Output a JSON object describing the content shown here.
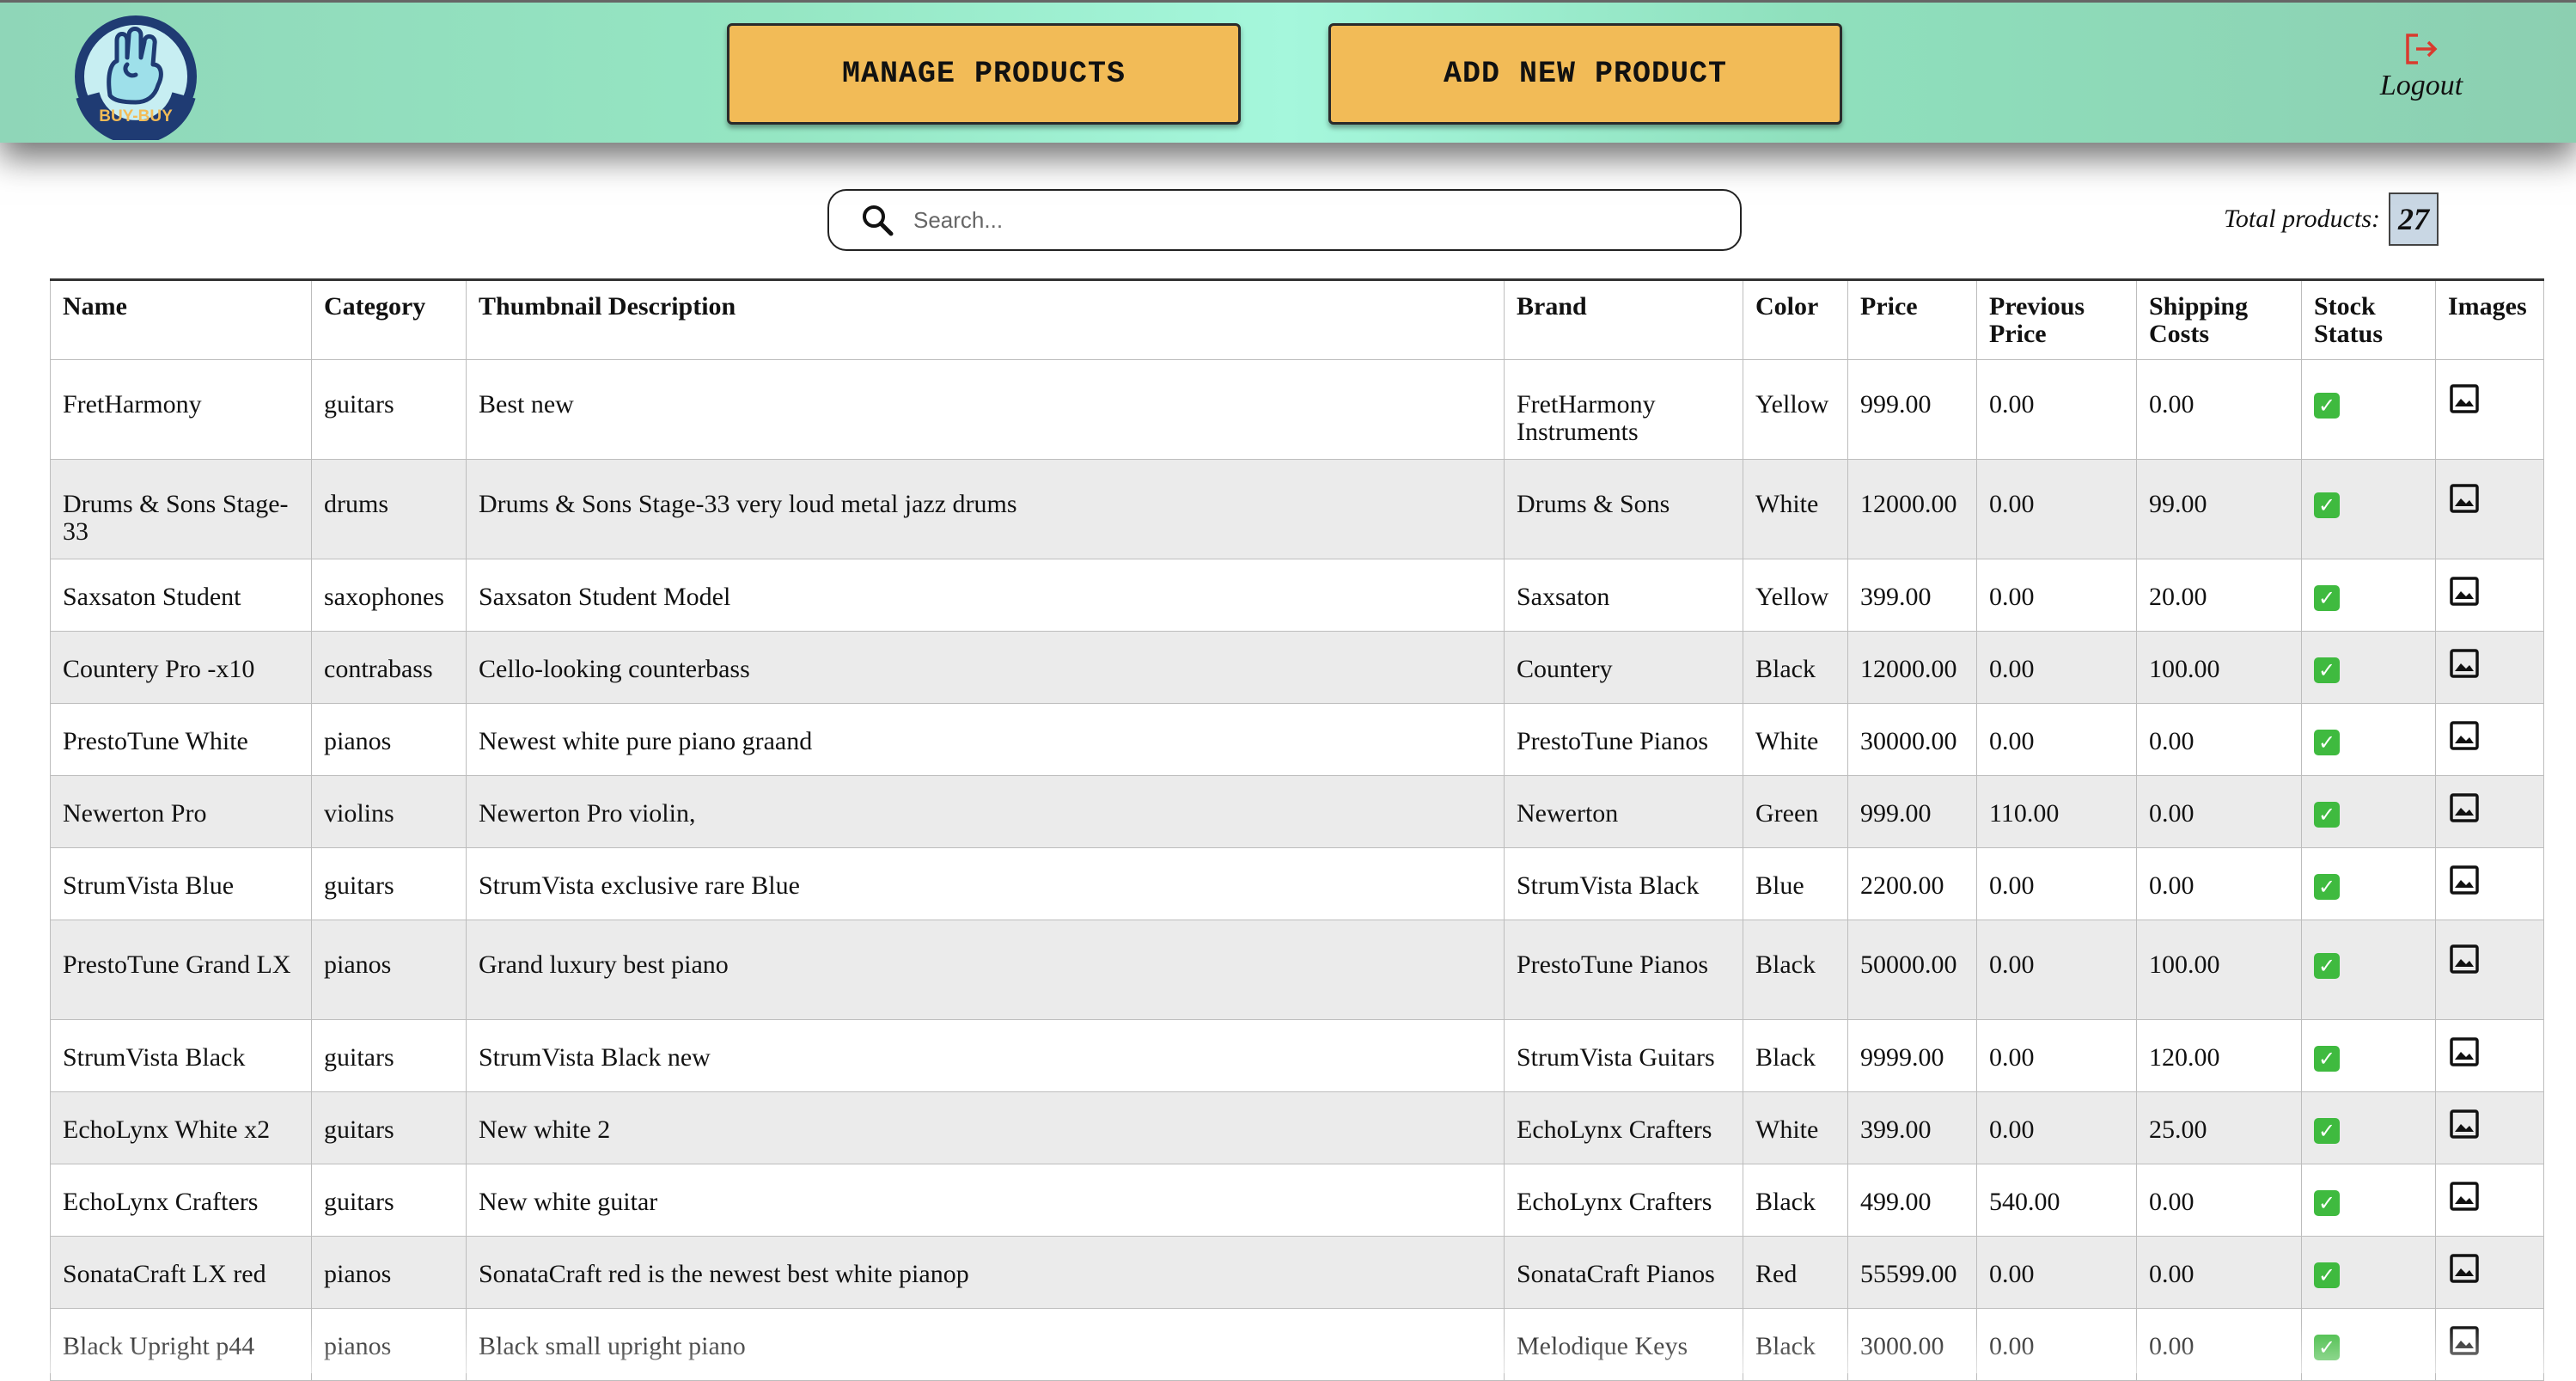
{
  "app": {
    "logo_text": "BUY-BUY"
  },
  "header": {
    "manage_label": "MANAGE PRODUCTS",
    "add_label": "ADD NEW PRODUCT",
    "logout_label": "Logout"
  },
  "search": {
    "placeholder": "Search...",
    "value": ""
  },
  "summary": {
    "total_label": "Total products:",
    "total_count": "27"
  },
  "table": {
    "columns": [
      "Name",
      "Category",
      "Thumbnail Description",
      "Brand",
      "Color",
      "Price",
      "Previous Price",
      "Shipping Costs",
      "Stock Status",
      "Images"
    ],
    "rows": [
      {
        "name": "FretHarmony",
        "category": "guitars",
        "description": "Best new",
        "brand": "FretHarmony Instruments",
        "color": "Yellow",
        "price": "999.00",
        "previous_price": "0.00",
        "shipping": "0.00",
        "in_stock": true
      },
      {
        "name": "Drums & Sons Stage-33",
        "category": "drums",
        "description": "Drums & Sons Stage-33 very loud metal jazz drums",
        "brand": "Drums & Sons",
        "color": "White",
        "price": "12000.00",
        "previous_price": "0.00",
        "shipping": "99.00",
        "in_stock": true
      },
      {
        "name": "Saxsaton Student",
        "category": "saxophones",
        "description": "Saxsaton Student Model",
        "brand": "Saxsaton",
        "color": "Yellow",
        "price": "399.00",
        "previous_price": "0.00",
        "shipping": "20.00",
        "in_stock": true
      },
      {
        "name": "Countery Pro -x10",
        "category": "contrabass",
        "description": "Cello-looking counterbass",
        "brand": "Countery",
        "color": "Black",
        "price": "12000.00",
        "previous_price": "0.00",
        "shipping": "100.00",
        "in_stock": true
      },
      {
        "name": "PrestoTune White",
        "category": "pianos",
        "description": "Newest white pure piano graand",
        "brand": "PrestoTune Pianos",
        "color": "White",
        "price": "30000.00",
        "previous_price": "0.00",
        "shipping": "0.00",
        "in_stock": true
      },
      {
        "name": "Newerton Pro",
        "category": "violins",
        "description": "Newerton Pro violin,",
        "brand": "Newerton",
        "color": "Green",
        "price": "999.00",
        "previous_price": "110.00",
        "shipping": "0.00",
        "in_stock": true
      },
      {
        "name": "StrumVista Blue",
        "category": "guitars",
        "description": "StrumVista exclusive rare Blue",
        "brand": "StrumVista Black",
        "color": "Blue",
        "price": "2200.00",
        "previous_price": "0.00",
        "shipping": "0.00",
        "in_stock": true
      },
      {
        "name": "PrestoTune Grand LX",
        "category": "pianos",
        "description": "Grand luxury best piano",
        "brand": "PrestoTune Pianos",
        "color": "Black",
        "price": "50000.00",
        "previous_price": "0.00",
        "shipping": "100.00",
        "in_stock": true
      },
      {
        "name": "StrumVista Black",
        "category": "guitars",
        "description": "StrumVista Black new",
        "brand": "StrumVista Guitars",
        "color": "Black",
        "price": "9999.00",
        "previous_price": "0.00",
        "shipping": "120.00",
        "in_stock": true
      },
      {
        "name": "EchoLynx White x2",
        "category": "guitars",
        "description": "New white 2",
        "brand": "EchoLynx Crafters",
        "color": "White",
        "price": "399.00",
        "previous_price": "0.00",
        "shipping": "25.00",
        "in_stock": true
      },
      {
        "name": "EchoLynx Crafters",
        "category": "guitars",
        "description": "New white guitar",
        "brand": "EchoLynx Crafters",
        "color": "Black",
        "price": "499.00",
        "previous_price": "540.00",
        "shipping": "0.00",
        "in_stock": true
      },
      {
        "name": "SonataCraft LX red",
        "category": "pianos",
        "description": "SonataCraft red is the newest best white pianop",
        "brand": "SonataCraft Pianos",
        "color": "Red",
        "price": "55599.00",
        "previous_price": "0.00",
        "shipping": "0.00",
        "in_stock": true
      },
      {
        "name": "Black Upright p44",
        "category": "pianos",
        "description": "Black small upright piano",
        "brand": "Melodique Keys",
        "color": "Black",
        "price": "3000.00",
        "previous_price": "0.00",
        "shipping": "0.00",
        "in_stock": true
      }
    ]
  },
  "icons": {
    "logo": "hand-logo-icon",
    "logout": "logout-icon",
    "search": "search-icon",
    "stock": "check-icon",
    "images": "image-icon"
  },
  "colors": {
    "header_bg": "#95e6c3",
    "button_bg": "#f2bb57",
    "stock_green": "#3fba3f",
    "logout_red": "#d93a2e",
    "row_alt": "#ebebeb"
  }
}
